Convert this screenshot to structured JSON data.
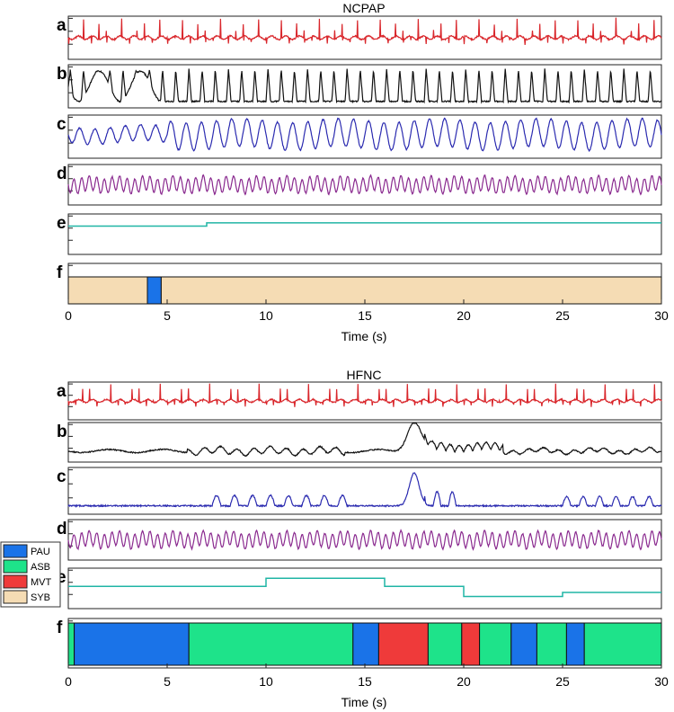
{
  "chart_data": [
    {
      "type": "line",
      "title": "NCPAP",
      "xlabel": "Time (s)",
      "xlim": [
        0,
        30
      ],
      "xticks": [
        0,
        5,
        10,
        15,
        20,
        25,
        30
      ],
      "panels": [
        {
          "label": "a",
          "color": "#d9262b",
          "pattern": "ecg",
          "rate_hz": 2.6
        },
        {
          "label": "b",
          "color": "#111111",
          "pattern": "sawtooth",
          "rate_hz": 1.5
        },
        {
          "label": "c",
          "color": "#2b2bb0",
          "pattern": "wave",
          "rate_hz": 1.3
        },
        {
          "label": "d",
          "color": "#8a2a8f",
          "pattern": "fastwave",
          "rate_hz": 2.6
        },
        {
          "label": "e",
          "color": "#20b5a5",
          "pattern": "flat",
          "levels": [
            [
              0,
              0.7
            ],
            [
              7,
              0.78
            ],
            [
              30,
              0.8
            ]
          ]
        },
        {
          "label": "f",
          "pattern": "states",
          "segments": [
            {
              "start": 0,
              "end": 4.0,
              "state": "SYB"
            },
            {
              "start": 4.0,
              "end": 4.7,
              "state": "PAU"
            },
            {
              "start": 4.7,
              "end": 30,
              "state": "SYB"
            }
          ]
        }
      ]
    },
    {
      "type": "line",
      "title": "HFNC",
      "xlabel": "Time (s)",
      "xlim": [
        0,
        30
      ],
      "xticks": [
        0,
        5,
        10,
        15,
        20,
        25,
        30
      ],
      "panels": [
        {
          "label": "a",
          "color": "#d9262b",
          "pattern": "ecg",
          "rate_hz": 2.8
        },
        {
          "label": "b",
          "color": "#111111",
          "pattern": "irregular",
          "peak_at": 17.5
        },
        {
          "label": "c",
          "color": "#2b2bb0",
          "pattern": "bursts",
          "peak_at": 17.5
        },
        {
          "label": "d",
          "color": "#8a2a8f",
          "pattern": "fastwave",
          "rate_hz": 2.6
        },
        {
          "label": "e",
          "color": "#20b5a5",
          "pattern": "flat",
          "levels": [
            [
              0,
              0.55
            ],
            [
              10,
              0.75
            ],
            [
              16,
              0.55
            ],
            [
              20,
              0.3
            ],
            [
              25,
              0.4
            ],
            [
              30,
              0.45
            ]
          ]
        },
        {
          "label": "f",
          "pattern": "states",
          "segments": [
            {
              "start": 0,
              "end": 0.3,
              "state": "ASB"
            },
            {
              "start": 0.3,
              "end": 6.1,
              "state": "PAU"
            },
            {
              "start": 6.1,
              "end": 14.4,
              "state": "ASB"
            },
            {
              "start": 14.4,
              "end": 15.7,
              "state": "PAU"
            },
            {
              "start": 15.7,
              "end": 18.2,
              "state": "MVT"
            },
            {
              "start": 18.2,
              "end": 19.9,
              "state": "ASB"
            },
            {
              "start": 19.9,
              "end": 20.8,
              "state": "MVT"
            },
            {
              "start": 20.8,
              "end": 22.4,
              "state": "ASB"
            },
            {
              "start": 22.4,
              "end": 23.7,
              "state": "PAU"
            },
            {
              "start": 23.7,
              "end": 25.2,
              "state": "ASB"
            },
            {
              "start": 25.2,
              "end": 26.1,
              "state": "PAU"
            },
            {
              "start": 26.1,
              "end": 30,
              "state": "ASB"
            }
          ]
        }
      ]
    }
  ],
  "legend": [
    {
      "label": "PAU",
      "color": "#1a73e8"
    },
    {
      "label": "ASB",
      "color": "#1ee38a"
    },
    {
      "label": "MVT",
      "color": "#ef3a3a"
    },
    {
      "label": "SYB",
      "color": "#f5dcb4"
    }
  ]
}
